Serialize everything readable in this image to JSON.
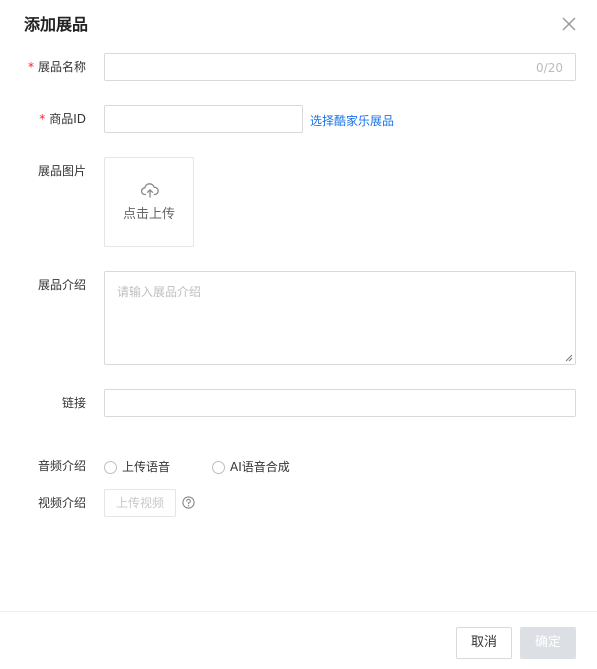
{
  "dialog": {
    "title": "添加展品",
    "close_icon": "close-icon"
  },
  "form": {
    "name": {
      "required_mark": "*",
      "label": "展品名称",
      "value": "",
      "counter": "0/20"
    },
    "product_id": {
      "required_mark": "*",
      "label": "商品ID",
      "value": "",
      "link_text": "选择酷家乐展品"
    },
    "image": {
      "label": "展品图片",
      "upload_text": "点击上传",
      "upload_icon": "cloud-upload-icon"
    },
    "intro": {
      "label": "展品介绍",
      "placeholder": "请输入展品介绍",
      "value": ""
    },
    "link": {
      "label": "链接",
      "value": ""
    },
    "audio": {
      "label": "音频介绍",
      "options": [
        {
          "label": "上传语音",
          "checked": false
        },
        {
          "label": "AI语音合成",
          "checked": false
        }
      ]
    },
    "video": {
      "label": "视频介绍",
      "button_text": "上传视频",
      "help_icon": "help-circle-icon"
    }
  },
  "footer": {
    "cancel_label": "取消",
    "ok_label": "确定"
  },
  "colors": {
    "required": "#f5222d",
    "link": "#1a73e8",
    "disabled_button": "#dcdfe3"
  }
}
